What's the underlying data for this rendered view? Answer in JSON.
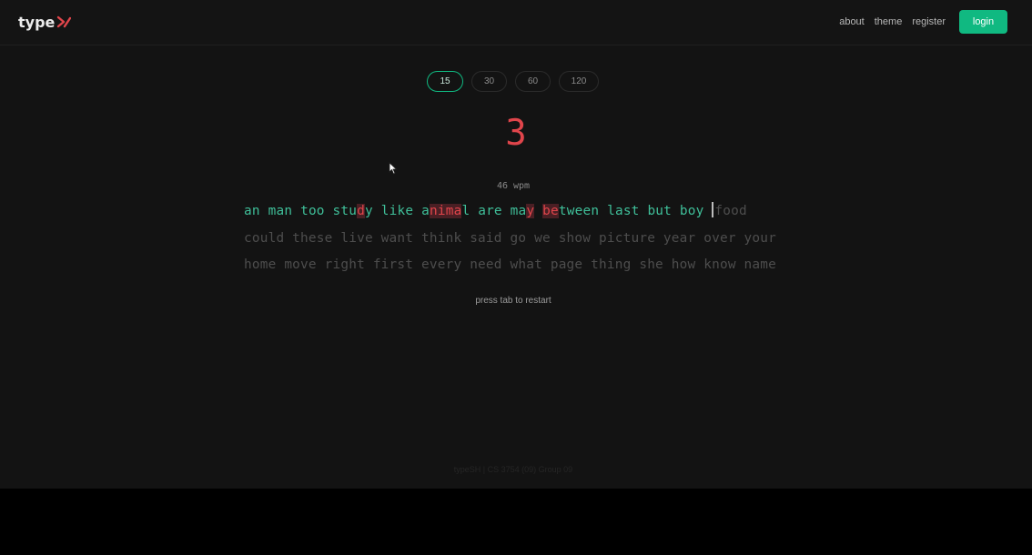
{
  "brand": {
    "name": "type",
    "logo_icon": "type-logo-icon",
    "accent": "#e0454b"
  },
  "nav": {
    "links": [
      "about",
      "theme",
      "register"
    ],
    "login_label": "login",
    "login_color": "#10b981"
  },
  "test": {
    "time_options": [
      "15",
      "30",
      "60",
      "120"
    ],
    "selected_time": "15",
    "countdown": "3",
    "wpm": "46 wpm",
    "restart_hint": "press tab to restart"
  },
  "words": {
    "typed_line": [
      "an",
      "man",
      "too",
      "study",
      "like",
      "animal",
      "are",
      "may",
      "between",
      "last",
      "but",
      "boy"
    ],
    "incorrect_letters": {
      "study": "d",
      "animal": "nima",
      "may": "y",
      "between": "be"
    },
    "current_word": "food",
    "upcoming_line_2": "could these live want think said go we show picture year over your",
    "upcoming_line_3": "home move right first every need what page thing she how know name",
    "colors": {
      "correct": "#3fbf99",
      "incorrect": "#e0454b",
      "untyped": "#4d4d4d"
    }
  },
  "footer": {
    "text": "typeSH | CS 3754 (09) Group 09"
  }
}
